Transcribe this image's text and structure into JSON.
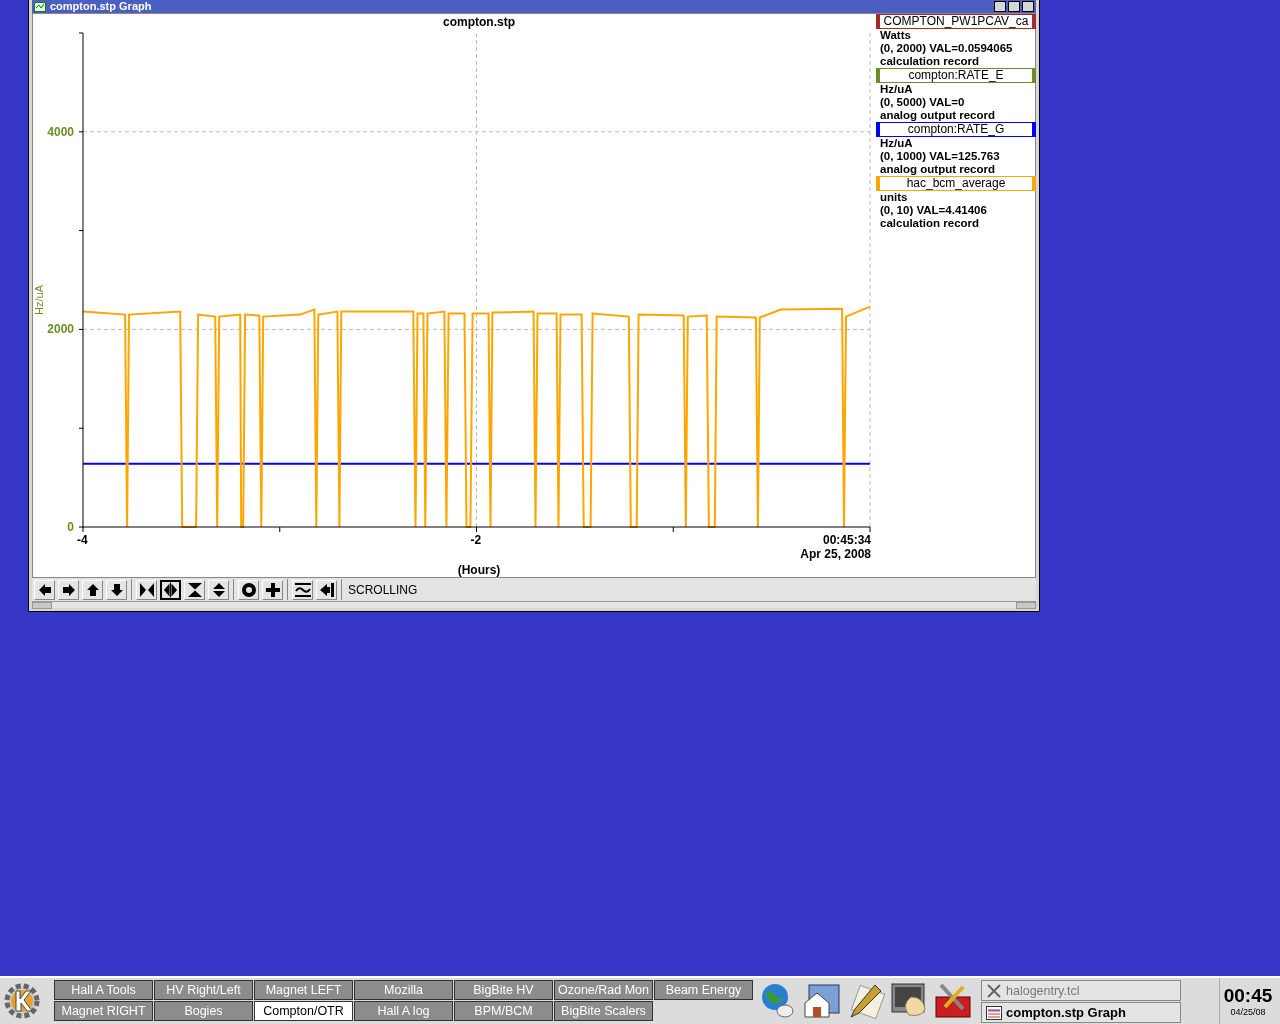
{
  "window": {
    "title": "compton.stp Graph"
  },
  "chart": {
    "chart_data": {
      "type": "line",
      "title": "compton.stp",
      "xlabel": "(Hours)",
      "ylabel": "Hz/uA",
      "grid": true,
      "xlim": [
        -4,
        0
      ],
      "ylim": [
        0,
        5000
      ],
      "xticks": [
        -4,
        -2,
        {
          "value": 0,
          "label": "00:45:34\nApr 25, 2008"
        }
      ],
      "yticks": [
        0,
        2000,
        4000
      ],
      "x": [
        -4,
        -3.786,
        -3.776,
        -3.766,
        -3.506,
        -3.496,
        -3.425,
        -3.415,
        -3.328,
        -3.318,
        -3.308,
        -3.201,
        -3.196,
        -3.186,
        -3.176,
        -3.104,
        -3.094,
        -3.084,
        -2.896,
        -2.824,
        -2.814,
        -2.804,
        -2.707,
        -2.697,
        -2.687,
        -2.321,
        -2.31,
        -2.3,
        -2.27,
        -2.26,
        -2.249,
        -2.163,
        -2.153,
        -2.142,
        -2.061,
        -2.051,
        -2.031,
        -2.02,
        -1.939,
        -1.929,
        -1.919,
        -1.71,
        -1.7,
        -1.69,
        -1.593,
        -1.583,
        -1.573,
        -1.466,
        -1.455,
        -1.42,
        -1.41,
        -1.226,
        -1.216,
        -1.186,
        -1.176,
        -0.947,
        -0.936,
        -0.926,
        -0.83,
        -0.819,
        -0.789,
        -0.779,
        -0.58,
        -0.57,
        -0.56,
        -0.453,
        -0.142,
        -0.132,
        -0.122,
        0
      ],
      "series": [
        {
          "color": "#0000ff",
          "values": [
            640,
            640,
            640,
            640,
            640,
            640,
            640,
            640,
            640,
            640,
            640,
            640,
            640,
            640,
            640,
            640,
            640,
            640,
            640,
            640,
            640,
            640,
            640,
            640,
            640,
            640,
            640,
            640,
            640,
            640,
            640,
            640,
            640,
            640,
            640,
            640,
            640,
            640,
            640,
            640,
            640,
            640,
            640,
            640,
            640,
            640,
            640,
            640,
            640,
            640,
            640,
            640,
            640,
            640,
            640,
            640,
            640,
            640,
            640,
            640,
            640,
            640,
            640,
            640,
            640,
            640,
            640,
            640,
            640,
            640
          ]
        },
        {
          "color": "#ffa500",
          "values": [
            2180,
            2150,
            0,
            2150,
            2180,
            0,
            0,
            2150,
            2130,
            0,
            2130,
            2150,
            0,
            0,
            2150,
            2140,
            0,
            2130,
            2150,
            2200,
            0,
            2150,
            2180,
            0,
            2180,
            2180,
            0,
            2160,
            2160,
            0,
            2160,
            2180,
            0,
            2160,
            2160,
            0,
            0,
            2160,
            2160,
            0,
            2170,
            2180,
            0,
            2160,
            2160,
            0,
            2150,
            2150,
            0,
            0,
            2160,
            2130,
            0,
            0,
            2150,
            2140,
            0,
            2130,
            2140,
            0,
            0,
            2130,
            2120,
            0,
            2120,
            2200,
            2210,
            0,
            2130,
            2230
          ]
        }
      ]
    }
  },
  "legend": [
    {
      "name": "COMPTON_PW1PCAV_ca",
      "color": "#a52a2a",
      "units": "Watts",
      "range": "(0, 2000) VAL=0.0594065",
      "record": "calculation record"
    },
    {
      "name": "compton:RATE_E",
      "color": "#6b8e23",
      "units": "Hz/uA",
      "range": "(0, 5000) VAL=0",
      "record": "analog output record"
    },
    {
      "name": "compton:RATE_G",
      "color": "#0000ff",
      "units": "Hz/uA",
      "range": "(0, 1000) VAL=125.763",
      "record": "analog output record"
    },
    {
      "name": "hac_bcm_average",
      "color": "#ffa500",
      "units": "units",
      "range": "(0, 10) VAL=4.41406",
      "record": "calculation record"
    }
  ],
  "toolbar": {
    "groups": [
      {
        "buttons": [
          {
            "kind": "left",
            "selected": false
          },
          {
            "kind": "right",
            "selected": false
          },
          {
            "kind": "up",
            "selected": false
          },
          {
            "kind": "down",
            "selected": false
          }
        ]
      },
      {
        "buttons": [
          {
            "kind": "zoom-in-x",
            "selected": false
          },
          {
            "kind": "zoom-out-x",
            "selected": true
          },
          {
            "kind": "zoom-in-y",
            "selected": false
          },
          {
            "kind": "zoom-out-y",
            "selected": false
          }
        ]
      },
      {
        "buttons": [
          {
            "kind": "circle",
            "selected": false
          },
          {
            "kind": "plus",
            "selected": false
          }
        ]
      },
      {
        "buttons": [
          {
            "kind": "wave",
            "selected": false
          },
          {
            "kind": "back",
            "selected": false
          }
        ]
      }
    ],
    "mode": "SCROLLING"
  },
  "taskbar": {
    "pager": [
      [
        {
          "label": "Hall A Tools",
          "selected": false
        },
        {
          "label": "HV Right/Left",
          "selected": false
        },
        {
          "label": "Magnet LEFT",
          "selected": false
        },
        {
          "label": "Mozilla",
          "selected": false
        },
        {
          "label": "BigBite HV",
          "selected": false
        },
        {
          "label": "Ozone/Rad Mon",
          "selected": false
        },
        {
          "label": "Beam Energy",
          "selected": false
        }
      ],
      [
        {
          "label": "Magnet RIGHT",
          "selected": false
        },
        {
          "label": "Bogies",
          "selected": false
        },
        {
          "label": "Compton/OTR",
          "selected": true
        },
        {
          "label": "Hall A log",
          "selected": false
        },
        {
          "label": "BPM/BCM",
          "selected": false
        },
        {
          "label": "BigBite Scalers",
          "selected": false
        }
      ]
    ],
    "tasks": [
      {
        "label": "halogentry.tcl",
        "kind": "x",
        "selected": false
      },
      {
        "label": "compton.stp Graph",
        "kind": "graph",
        "selected": true
      }
    ],
    "clock": {
      "time": "00:45",
      "date": "04/25/08"
    }
  }
}
